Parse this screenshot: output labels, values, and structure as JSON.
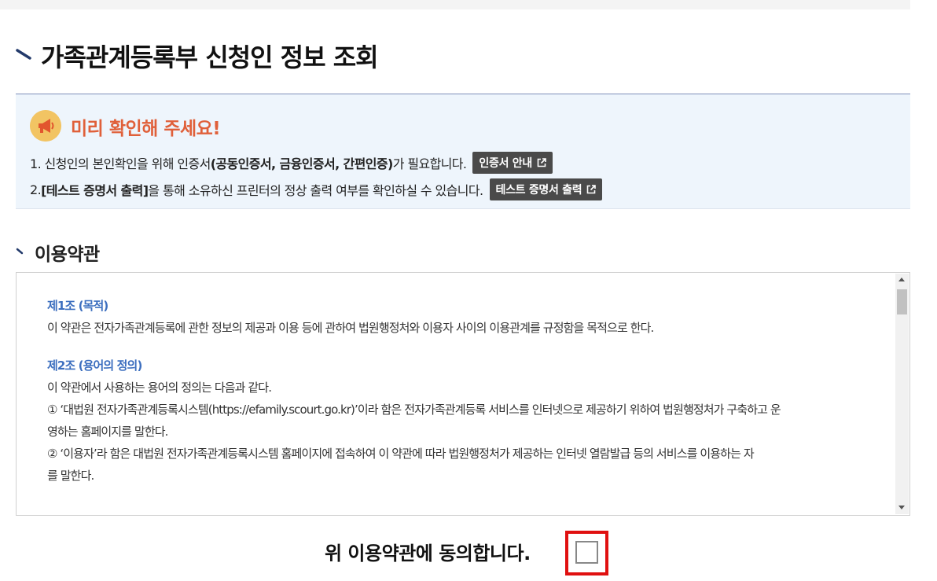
{
  "page": {
    "title": "가족관계등록부 신청인 정보 조회"
  },
  "notice": {
    "icon": "megaphone-icon",
    "heading": "미리 확인해 주세요!",
    "line1": {
      "prefix": "1. 신청인의 본인확인을 위해 인증서",
      "bold": "(공동인증서, 금융인증서, 간편인증)",
      "suffix": "가 필요합니다.",
      "button_label": "인증서 안내"
    },
    "line2": {
      "prefix": "2. ",
      "bold": "[테스트 증명서 출력]",
      "suffix": "을 통해 소유하신 프린터의 정상 출력 여부를 확인하실 수 있습니다.",
      "button_label": "테스트 증명서 출력"
    }
  },
  "terms": {
    "section_title": "이용약관",
    "article1_title": "제1조 (목적)",
    "article1_body": "이 약관은 전자가족관계등록에 관한 정보의 제공과 이용 등에 관하여 법원행정처와 이용자 사이의 이용관계를 규정함을 목적으로 한다.",
    "article2_title": "제2조 (용어의 정의)",
    "article2_intro": "이 약관에서 사용하는 용어의 정의는 다음과 같다.",
    "article2_item1_line1": "① ‘대법원 전자가족관계등록시스템(https://efamily.scourt.go.kr)’이라 함은 전자가족관계등록 서비스를 인터넷으로 제공하기 위하여 법원행정처가 구축하고 운",
    "article2_item1_line2": "영하는 홈페이지를 말한다.",
    "article2_item2_line1": "② ‘이용자’라 함은 대법원 전자가족관계등록시스템 홈페이지에 접속하여 이 약관에 따라 법원행정처가 제공하는 인터넷 열람발급 등의 서비스를 이용하는 자",
    "article2_item2_line2": "를 말한다."
  },
  "agreement": {
    "label": "위 이용약관에 동의합니다.",
    "checked": false
  },
  "colors": {
    "notice_heading": "#e0603a",
    "article_title": "#3d6fbf",
    "notice_bg": "#eef5fc",
    "highlight_frame": "#e01010"
  }
}
